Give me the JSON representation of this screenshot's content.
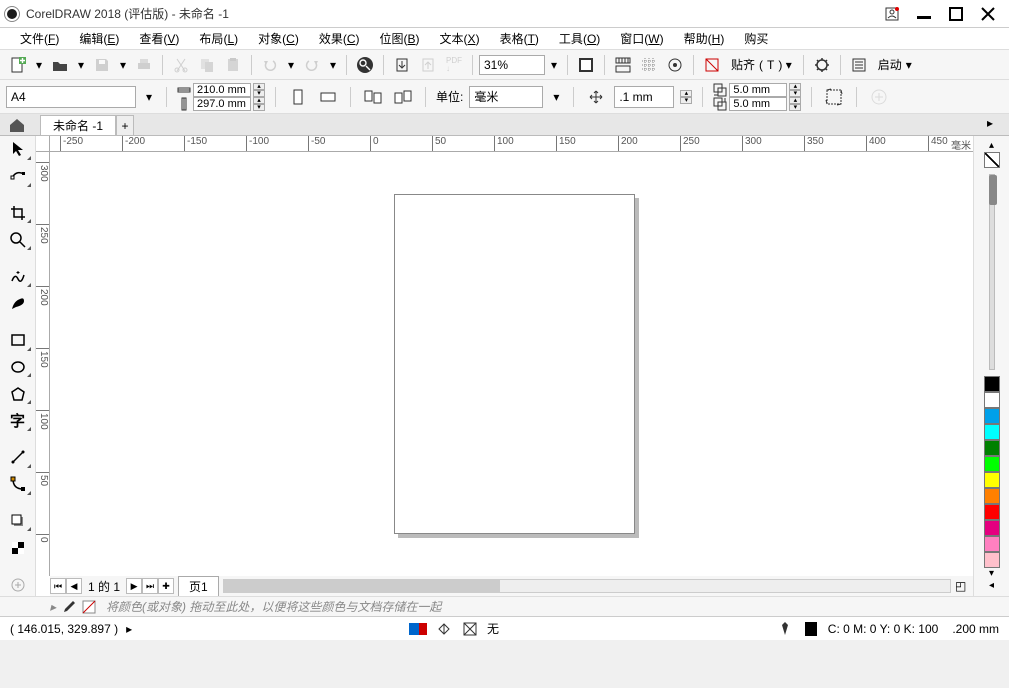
{
  "app": {
    "title": "CorelDRAW 2018 (评估版) - 未命名 -1"
  },
  "menu": {
    "file": {
      "text": "文件",
      "key": "F"
    },
    "edit": {
      "text": "编辑",
      "key": "E"
    },
    "view": {
      "text": "查看",
      "key": "V"
    },
    "layout": {
      "text": "布局",
      "key": "L"
    },
    "object": {
      "text": "对象",
      "key": "C"
    },
    "effects": {
      "text": "效果",
      "key": "C"
    },
    "bitmap": {
      "text": "位图",
      "key": "B"
    },
    "text": {
      "text": "文本",
      "key": "X"
    },
    "table": {
      "text": "表格",
      "key": "T"
    },
    "tools": {
      "text": "工具",
      "key": "O"
    },
    "window": {
      "text": "窗口",
      "key": "W"
    },
    "help": {
      "text": "帮助",
      "key": "H"
    },
    "buy": {
      "text": "购买"
    }
  },
  "toolbar1": {
    "zoom": "31%",
    "paste_label": "贴齐",
    "paste_key": "T",
    "launch_label": "启动"
  },
  "props": {
    "page_preset": "A4",
    "width": "210.0 mm",
    "height": "297.0 mm",
    "units_label": "单位:",
    "units_value": "毫米",
    "nudge": ".1 mm",
    "dupx": "5.0 mm",
    "dupy": "5.0 mm"
  },
  "doc": {
    "tab": "未命名 -1",
    "page_label": "页1",
    "page_nav": "1 的 1"
  },
  "ruler": {
    "h": [
      "-250",
      "-200",
      "-150",
      "-100",
      "-50",
      "0",
      "50",
      "100",
      "150",
      "200",
      "250",
      "300",
      "350",
      "400",
      "450"
    ],
    "h_unit": "毫米",
    "v": [
      "300",
      "250",
      "200",
      "150",
      "100",
      "50",
      "0"
    ]
  },
  "palette_colors": [
    "#000000",
    "#ffffff",
    "#00a0e9",
    "#00ffff",
    "#008000",
    "#00ff00",
    "#ffff00",
    "#ff8000",
    "#ff0000",
    "#e4007f",
    "#ff80c0",
    "#ffc0cb"
  ],
  "colordrop_hint": "将颜色(或对象) 拖动至此处，以便将这些颜色与文档存储在一起",
  "status": {
    "coords": "( 146.015, 329.897 )",
    "fill_label": "无",
    "cmyk": "C: 0 M: 0 Y: 0 K: 100",
    "outline": ".200 mm"
  }
}
